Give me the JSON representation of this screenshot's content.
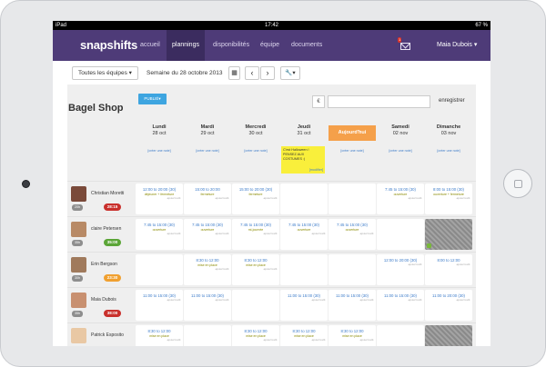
{
  "status": {
    "left": "iPad",
    "time": "17:42",
    "battery": "67 %"
  },
  "nav": {
    "logo": "snapshifts",
    "items": [
      "accueil",
      "plannings",
      "disponibilités",
      "équipe",
      "documents"
    ],
    "mail_count": "1",
    "user": "Maia Dubois ▾"
  },
  "toolbar": {
    "teams": "Toutes les équipes ▾",
    "week": "Semaine du 28 octobre 2013",
    "calendar_icon": "calendar-icon",
    "prev": "‹",
    "next": "›",
    "tools": "🔧▾"
  },
  "board": {
    "shop": "Bagel Shop",
    "publie": "PUBLIÉ▾",
    "currency": "€",
    "save": "enregistrer",
    "days": [
      {
        "name": "Lundi",
        "date": "28 oct"
      },
      {
        "name": "Mardi",
        "date": "29 oct"
      },
      {
        "name": "Mercredi",
        "date": "30 oct"
      },
      {
        "name": "Jeudi",
        "date": "31 oct"
      },
      {
        "name": "Aujourd'hui",
        "date": ""
      },
      {
        "name": "Samedi",
        "date": "02 nov"
      },
      {
        "name": "Dimanche",
        "date": "03 nov"
      }
    ],
    "note_link": "[créer une note]",
    "sticky_text": "C'est Halloween ! PENSEZ AUX COSTUMES :)",
    "sticky_mod": "[modifier]",
    "modif": "-ajouter/modif-",
    "rows": [
      {
        "name": "Christian Moretti",
        "hours": "20h",
        "over": "28:15",
        "over_color": "#c9302c",
        "cells": [
          {
            "time": "12:00 to 20:00 (30)",
            "role": "déjeuner + fermeture"
          },
          {
            "time": "15:00 to 20:00",
            "role": "fermeture"
          },
          {
            "time": "15:00 to 20:00 (30)",
            "role": "fermeture"
          },
          null,
          null,
          {
            "time": "7:45 to 15:00 (30)",
            "role": "ouverture"
          },
          {
            "time": "8:00 to 15:00 (30)",
            "role": "ouverture + fermeture"
          }
        ]
      },
      {
        "name": "claire Petersen",
        "hours": "35h",
        "over": "35:00",
        "over_color": "#5ba537",
        "cells": [
          {
            "time": "7:45 to 15:00 (30)",
            "role": "ouverture"
          },
          {
            "time": "7:45 to 15:00 (30)",
            "role": "ouverture"
          },
          {
            "time": "7:45 to 15:00 (30)",
            "role": "mi-journée"
          },
          {
            "time": "7:45 to 15:00 (30)",
            "role": "ouverture"
          },
          {
            "time": "7:45 to 15:00 (30)",
            "role": "ouverture"
          },
          null,
          "hatch-check"
        ]
      },
      {
        "name": "Erin Bergson",
        "hours": "30h",
        "over": "23:30",
        "over_color": "#f0a030",
        "cells": [
          null,
          {
            "time": "8:30 to 12:00",
            "role": "mise en place"
          },
          {
            "time": "8:30 to 12:00",
            "role": "mise en place"
          },
          null,
          null,
          {
            "time": "12:00 to 20:00 (30)",
            "role": ""
          },
          {
            "time": "8:00 to 12:00",
            "role": ""
          }
        ]
      },
      {
        "name": "Maia Dubois",
        "hours": "35h",
        "over": "38:00",
        "over_color": "#c9302c",
        "cells": [
          {
            "time": "11:00 to 15:00 (30)",
            "role": ""
          },
          {
            "time": "11:00 to 15:00 (30)",
            "role": ""
          },
          null,
          {
            "time": "11:00 to 15:00 (30)",
            "role": ""
          },
          {
            "time": "11:00 to 15:00 (30)",
            "role": ""
          },
          {
            "time": "11:00 to 15:00 (30)",
            "role": ""
          },
          {
            "time": "11:00 to 20:00 (30)",
            "role": ""
          }
        ]
      },
      {
        "name": "Patrick Esposito",
        "hours": "30h",
        "over": "",
        "over_color": "#c9302c",
        "cells": [
          {
            "time": "8:30 to 12:00",
            "role": "mise en place"
          },
          null,
          {
            "time": "8:30 to 12:00",
            "role": "mise en place"
          },
          {
            "time": "8:30 to 12:00",
            "role": "mise en place"
          },
          {
            "time": "8:30 to 12:00",
            "role": "mise en place"
          },
          null,
          "hatch"
        ]
      }
    ]
  }
}
